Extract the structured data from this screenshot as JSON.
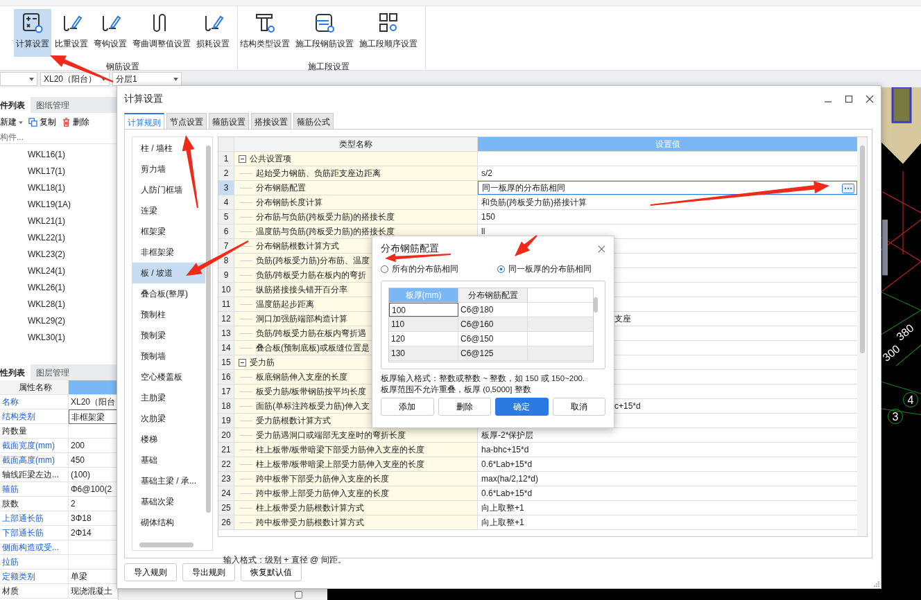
{
  "ribbon": {
    "groups": [
      {
        "label": "钢筋设置",
        "buttons": [
          {
            "label": "计算设置",
            "selected": true
          },
          {
            "label": "比重设置",
            "selected": false
          },
          {
            "label": "弯钩设置",
            "selected": false
          },
          {
            "label": "弯曲调整值设置",
            "selected": false
          },
          {
            "label": "损耗设置",
            "selected": false
          }
        ]
      },
      {
        "label": "施工段设置",
        "buttons": [
          {
            "label": "结构类型设置",
            "selected": false
          },
          {
            "label": "施工段钢筋设置",
            "selected": false
          },
          {
            "label": "施工段顺序设置",
            "selected": false
          }
        ]
      }
    ]
  },
  "combos": [
    {
      "value": "XL20（阳台）"
    },
    {
      "value": "分层1"
    }
  ],
  "component_panel": {
    "tabs": [
      {
        "label": "件列表",
        "selected": true
      },
      {
        "label": "图纸管理",
        "selected": false
      }
    ],
    "toolbar": [
      {
        "label": "新建"
      },
      {
        "label": "复制"
      },
      {
        "label": "删除"
      }
    ],
    "search": {
      "placeholder": "构件..."
    },
    "items": [
      "WKL16(1)",
      "WKL17(1)",
      "WKL18(1)",
      "WKL19(1A)",
      "WKL21(1)",
      "WKL22(1)",
      "WKL23(2)",
      "WKL24(1)",
      "WKL26(1)",
      "WKL28(1)",
      "WKL29(2)",
      "WKL30(1)"
    ]
  },
  "property_panel": {
    "tabs": [
      {
        "label": "性列表",
        "selected": true
      },
      {
        "label": "图层管理",
        "selected": false
      }
    ],
    "header": "属性名称",
    "rows": [
      {
        "name": "名称",
        "value": "XL20（阳台",
        "public": true,
        "selected": false
      },
      {
        "name": "结构类别",
        "value": "非框架梁",
        "public": true,
        "selected": true
      },
      {
        "name": "跨数量",
        "public": false,
        "selected": false
      },
      {
        "name": "截面宽度(mm)",
        "value": "200",
        "public": true,
        "selected": false
      },
      {
        "name": "截面高度(mm)",
        "value": "450",
        "public": true,
        "selected": false
      },
      {
        "name": "轴线距梁左边...",
        "value": "(100)",
        "public": false,
        "selected": false
      },
      {
        "name": "箍筋",
        "value": "Φ6@100(2",
        "public": true,
        "selected": false
      },
      {
        "name": "肢数",
        "value": "2",
        "public": false,
        "selected": false
      },
      {
        "name": "上部通长筋",
        "value": "3Φ18",
        "public": true,
        "selected": false
      },
      {
        "name": "下部通长筋",
        "value": "2Φ14",
        "public": true,
        "selected": false
      },
      {
        "name": "侧面构造或受...",
        "public": true,
        "selected": false
      },
      {
        "name": "拉筋",
        "public": true,
        "selected": false
      },
      {
        "name": "定额类别",
        "value": "单梁",
        "public": true,
        "selected": false
      },
      {
        "name": "材质",
        "value": "现浇混凝土",
        "public": false,
        "selected": false
      }
    ]
  },
  "middle_checkbox": {
    "checked": false
  },
  "viewport": {
    "labels": [
      "380",
      "300",
      "4",
      "3"
    ]
  },
  "dialog": {
    "title": "计算设置",
    "tabs": [
      {
        "label": "计算规则",
        "selected": true
      },
      {
        "label": "节点设置",
        "selected": false
      },
      {
        "label": "箍筋设置",
        "selected": false
      },
      {
        "label": "搭接设置",
        "selected": false
      },
      {
        "label": "箍筋公式",
        "selected": false
      }
    ],
    "categories": [
      {
        "label": "柱 / 墙柱",
        "selected": false
      },
      {
        "label": "剪力墙",
        "selected": false
      },
      {
        "label": "人防门框墙",
        "selected": false
      },
      {
        "label": "连梁",
        "selected": false
      },
      {
        "label": "框架梁",
        "selected": false
      },
      {
        "label": "非框架梁",
        "selected": false
      },
      {
        "label": "板 / 坡道",
        "selected": true
      },
      {
        "label": "叠合板(整厚)",
        "selected": false
      },
      {
        "label": "预制柱",
        "selected": false
      },
      {
        "label": "预制梁",
        "selected": false
      },
      {
        "label": "预制墙",
        "selected": false
      },
      {
        "label": "空心楼盖板",
        "selected": false
      },
      {
        "label": "主肋梁",
        "selected": false
      },
      {
        "label": "次肋梁",
        "selected": false
      },
      {
        "label": "楼梯",
        "selected": false
      },
      {
        "label": "基础",
        "selected": false
      },
      {
        "label": "基础主梁 / 承...",
        "selected": false
      },
      {
        "label": "基础次梁",
        "selected": false
      },
      {
        "label": "砌体结构",
        "selected": false
      }
    ],
    "columns": [
      {
        "label": "类型名称",
        "selected": false
      },
      {
        "label": "设置值",
        "selected": true
      }
    ],
    "rows": [
      {
        "no": "1",
        "kind": "group",
        "name": "公共设置项",
        "expanded": true,
        "selected": false
      },
      {
        "no": "2",
        "kind": "item",
        "name": "起始受力钢筋、负筋距支座边距离",
        "value": "s/2",
        "selected": false
      },
      {
        "no": "3",
        "kind": "item",
        "name": "分布钢筋配置",
        "value": "同一板厚的分布筋相同",
        "selected": true
      },
      {
        "no": "4",
        "kind": "item",
        "name": "分布钢筋长度计算",
        "value": "和负筋(跨板受力筋)搭接计算",
        "selected": false
      },
      {
        "no": "5",
        "kind": "item",
        "name": "分布筋与负筋(跨板受力筋)的搭接长度",
        "value": "150",
        "selected": false
      },
      {
        "no": "6",
        "kind": "item",
        "name": "温度筋与负筋(跨板受力筋)的搭接长度",
        "value": "ll",
        "selected": false
      },
      {
        "no": "7",
        "kind": "item",
        "name": "分布钢筋根数计算方式",
        "selected": false
      },
      {
        "no": "8",
        "kind": "item",
        "name": "负筋(跨板受力筋)分布筋、温度",
        "selected": false
      },
      {
        "no": "9",
        "kind": "item",
        "name": "负筋/跨板受力筋在板内的弯折",
        "selected": false
      },
      {
        "no": "10",
        "kind": "item",
        "name": "纵筋搭接接头错开百分率",
        "selected": false
      },
      {
        "no": "11",
        "kind": "item",
        "name": "温度筋起步距离",
        "selected": false
      },
      {
        "no": "12",
        "kind": "item",
        "name": "洞口加强筋端部构造计算",
        "value_tail": "支座",
        "selected": false
      },
      {
        "no": "13",
        "kind": "item",
        "name": "负筋/跨板受力筋在板内弯折遇",
        "selected": false
      },
      {
        "no": "14",
        "kind": "item",
        "name": "叠合板(预制底板)或板缝位置是",
        "selected": false
      },
      {
        "no": "15",
        "kind": "group",
        "name": "受力筋",
        "expanded": true,
        "selected": false
      },
      {
        "no": "16",
        "kind": "item",
        "name": "板底钢筋伸入支座的长度",
        "selected": false
      },
      {
        "no": "17",
        "kind": "item",
        "name": "板受力筋/板带钢筋按平均长度",
        "selected": false
      },
      {
        "no": "18",
        "kind": "item",
        "name": "面筋(单标注跨板受力筋)伸入支",
        "value_tail": "c+15*d",
        "selected": false
      },
      {
        "no": "19",
        "kind": "item",
        "name": "受力筋根数计算方式",
        "selected": false
      },
      {
        "no": "20",
        "kind": "item",
        "name": "受力筋遇洞口或端部无支座时的弯折长度",
        "value": "板厚-2*保护层",
        "selected": false
      },
      {
        "no": "21",
        "kind": "item",
        "name": "柱上板带/板带暗梁下部受力筋伸入支座的长度",
        "value": "ha-bhc+15*d",
        "selected": false
      },
      {
        "no": "22",
        "kind": "item",
        "name": "柱上板带/板带暗梁上部受力筋伸入支座的长度",
        "value": "0.6*Lab+15*d",
        "selected": false
      },
      {
        "no": "23",
        "kind": "item",
        "name": "跨中板带下部受力筋伸入支座的长度",
        "value": "max(ha/2,12*d)",
        "selected": false
      },
      {
        "no": "24",
        "kind": "item",
        "name": "跨中板带上部受力筋伸入支座的长度",
        "value": "0.6*Lab+15*d",
        "selected": false
      },
      {
        "no": "25",
        "kind": "item",
        "name": "柱上板带受力筋根数计算方式",
        "value": "向上取整+1",
        "selected": false
      },
      {
        "no": "26",
        "kind": "item",
        "name": "跨中板带受力筋根数计算方式",
        "value": "向上取整+1",
        "selected": false
      }
    ],
    "hint": "输入格式：级别 + 直径 @ 间距。",
    "buttons": [
      "导入规则",
      "导出规则",
      "恢复默认值"
    ]
  },
  "sub_dialog": {
    "title": "分布钢筋配置",
    "options": [
      {
        "label": "所有的分布筋相同",
        "selected": false
      },
      {
        "label": "同一板厚的分布筋相同",
        "selected": true
      }
    ],
    "columns": [
      {
        "label": "板厚(mm)",
        "selected": true
      },
      {
        "label": "分布钢筋配置",
        "selected": false
      }
    ],
    "rows": [
      {
        "thickness": "100",
        "config": "C6@180",
        "selected": true
      },
      {
        "thickness": "110",
        "config": "C6@160",
        "selected": false
      },
      {
        "thickness": "120",
        "config": "C6@150",
        "selected": false
      },
      {
        "thickness": "130",
        "config": "C6@125",
        "selected": false
      }
    ],
    "hint": [
      "板厚输入格式：整数或整数 ~ 整数，如 150 或 150~200.",
      "板厚范围不允许重叠，板厚 (0,5000] 整数"
    ],
    "buttons": [
      {
        "label": "添加",
        "kind": "normal"
      },
      {
        "label": "删除",
        "kind": "normal"
      },
      {
        "label": "确定",
        "kind": "primary"
      },
      {
        "label": "取消",
        "kind": "normal"
      }
    ]
  }
}
